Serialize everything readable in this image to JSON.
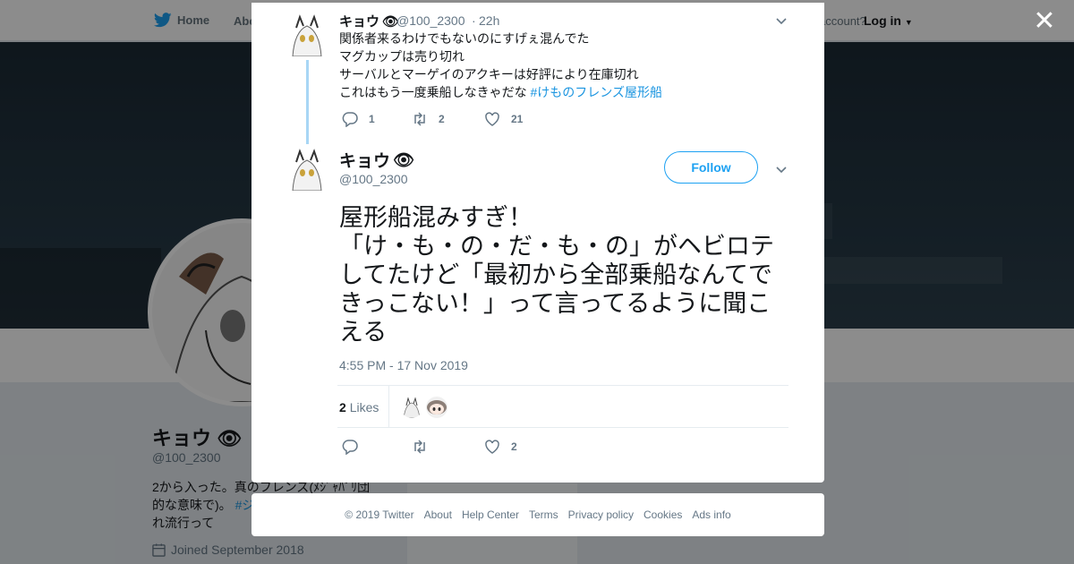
{
  "background": {
    "nav": {
      "home": "Home",
      "about": "Abo",
      "have_account": "account?",
      "login": "Log in"
    },
    "profile": {
      "name": "キョウ",
      "handle": "@100_2300",
      "bio_1": "2から入った。真のフレンズ(ﾒｼﾞｬﾊﾟﾘ団",
      "bio_2a": "的な意味で)。",
      "bio_2b": "#ジ",
      "bio_3": "れ流行って",
      "joined": "Joined September 2018"
    }
  },
  "parent_tweet": {
    "name": "キョウ",
    "handle": "@100_2300",
    "dot": "·",
    "time": "22h",
    "lines": [
      "関係者来るわけでもないのにすげぇ混んでた",
      "マグカップは売り切れ",
      "サーバルとマーゲイのアクキーは好評により在庫切れ"
    ],
    "line4": "これはもう一度乗船しなきゃだな",
    "hashtag": "#けものフレンズ屋形船",
    "replies": "1",
    "retweets": "2",
    "likes": "21"
  },
  "main_tweet": {
    "name": "キョウ",
    "handle": "@100_2300",
    "follow_label": "Follow",
    "text": "屋形船混みすぎ！\n「け・も・の・だ・も・の」がヘビロテしてたけど「最初から全部乗船なんてできっこない！」って言ってるように聞こえる",
    "timestamp": "4:55 PM - 17 Nov 2019",
    "likes_count": "2",
    "likes_label": "Likes",
    "action_likes": "2"
  },
  "footer": {
    "items": [
      "© 2019 Twitter",
      "About",
      "Help Center",
      "Terms",
      "Privacy policy",
      "Cookies",
      "Ads info"
    ]
  },
  "colors": {
    "accent": "#1da1f2",
    "hashtag": "#1b95e0",
    "thread_line": "#a8d6f5",
    "muted": "#657786"
  },
  "icons": [
    "twitter-bird-icon",
    "close-icon",
    "chevron-down-icon",
    "reply-icon",
    "retweet-icon",
    "heart-icon",
    "calendar-icon",
    "eye-emoji-icon"
  ]
}
